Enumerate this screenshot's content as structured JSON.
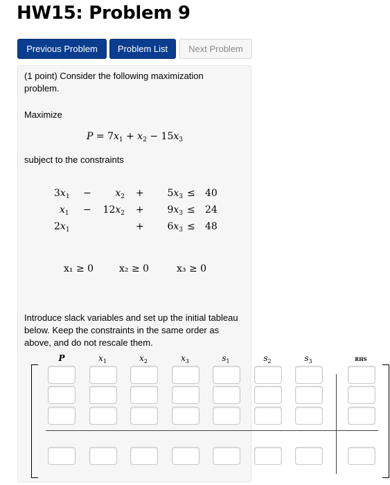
{
  "page_title": "HW15: Problem 9",
  "nav": {
    "previous_label": "Previous Problem",
    "list_label": "Problem List",
    "next_label": "Next Problem"
  },
  "problem": {
    "intro": "(1 point) Consider the following maximization problem.",
    "maximize_label": "Maximize",
    "objective": {
      "lhs": "P",
      "x1_coef": "7",
      "x2_coef": "",
      "x3_coef": "15"
    },
    "subject_to": "subject to the constraints",
    "constraints": [
      {
        "a1": "3",
        "op1": "−",
        "a2": "",
        "op2": "+",
        "a3": "5",
        "rel": "≤",
        "rhs": "40"
      },
      {
        "a1": "",
        "op1": "−",
        "a2": "12",
        "op2": "+",
        "a3": "9",
        "rel": "≤",
        "rhs": "24"
      },
      {
        "a1": "2",
        "op1": "",
        "a2": "",
        "op2": "+",
        "a3": "6",
        "rel": "≤",
        "rhs": "48"
      }
    ],
    "nonneg": [
      "x₁ ≥ 0",
      "x₂ ≥ 0",
      "x₃ ≥ 0"
    ],
    "instructions": "Introduce slack variables and set up the initial tableau below. Keep the constraints in the same order as above, and do not rescale them."
  },
  "tableau": {
    "headers": [
      "P",
      "x1",
      "x2",
      "x3",
      "s1",
      "s2",
      "s3",
      "RHS"
    ],
    "rows": [
      [
        "",
        "",
        "",
        "",
        "",
        "",
        "",
        ""
      ],
      [
        "",
        "",
        "",
        "",
        "",
        "",
        "",
        ""
      ],
      [
        "",
        "",
        "",
        "",
        "",
        "",
        "",
        ""
      ],
      [
        "",
        "",
        "",
        "",
        "",
        "",
        "",
        ""
      ]
    ]
  }
}
